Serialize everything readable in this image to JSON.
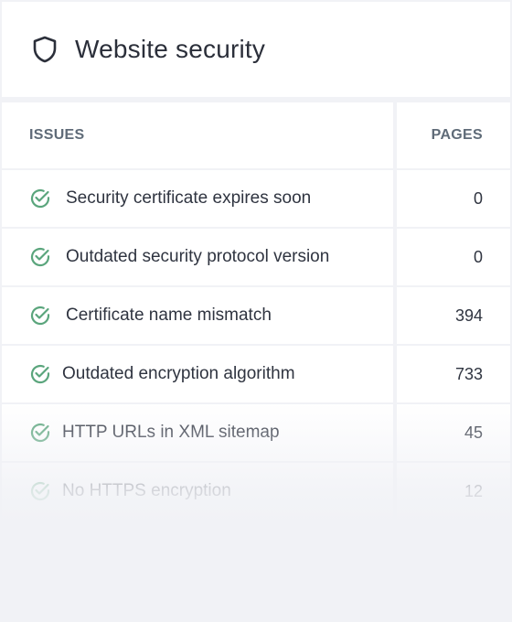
{
  "card": {
    "title": "Website security",
    "icon": "shield-icon"
  },
  "table": {
    "headers": {
      "issues": "ISSUES",
      "pages": "PAGES"
    },
    "rows": [
      {
        "issue": "Security certificate expires soon",
        "pages": "0",
        "icon": "check-circle-icon",
        "status": "passed"
      },
      {
        "issue": "Outdated security protocol version",
        "pages": "0",
        "icon": "check-circle-icon",
        "status": "passed"
      },
      {
        "issue": "Certificate name mismatch",
        "pages": "394",
        "icon": "check-circle-icon",
        "status": "passed"
      },
      {
        "issue": "Outdated encryption algorithm",
        "pages": "733",
        "icon": "check-circle-icon",
        "status": "passed"
      },
      {
        "issue": "HTTP URLs in XML sitemap",
        "pages": "45",
        "icon": "check-circle-icon",
        "status": "passed"
      },
      {
        "issue": "No HTTPS encryption",
        "pages": "12",
        "icon": "check-circle-icon",
        "status": "passed"
      }
    ]
  },
  "colors": {
    "check_green": "#5aa57c",
    "header_text": "#5f6b78",
    "background": "#f1f2f6"
  }
}
